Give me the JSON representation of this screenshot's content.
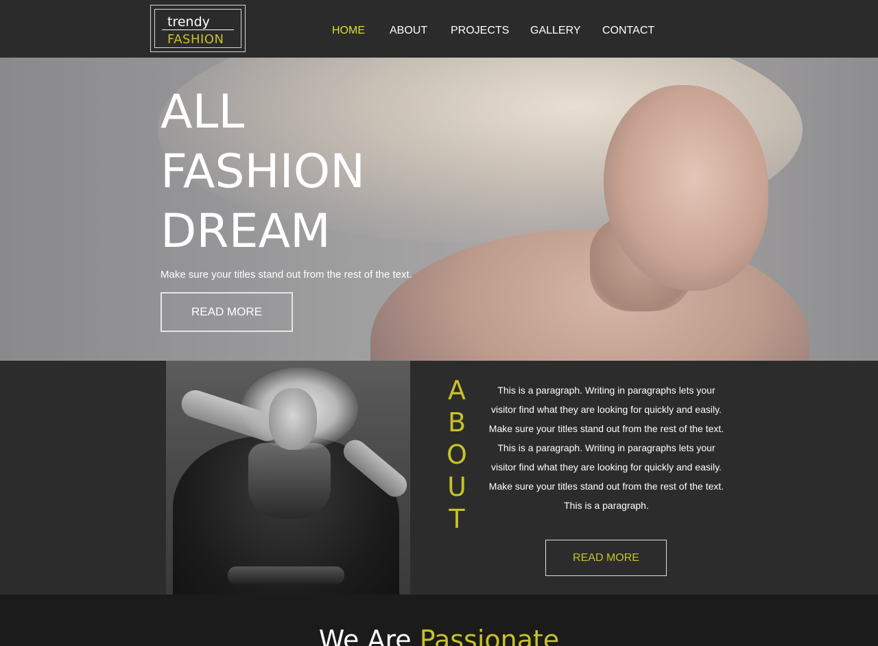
{
  "logo": {
    "line1": "trendy",
    "line2": "FASHION"
  },
  "nav": {
    "items": [
      {
        "label": "HOME",
        "active": true
      },
      {
        "label": "ABOUT",
        "active": false
      },
      {
        "label": "PROJECTS",
        "active": false
      },
      {
        "label": "GALLERY",
        "active": false
      },
      {
        "label": "CONTACT",
        "active": false
      }
    ]
  },
  "hero": {
    "title_lines": [
      "ALL",
      "FASHION",
      "DREAM"
    ],
    "subtitle": "Make sure your titles stand out from the rest of the text.",
    "button_label": "READ MORE"
  },
  "about": {
    "letters": [
      "A",
      "B",
      "O",
      "U",
      "T"
    ],
    "paragraph": "This is a paragraph. Writing in paragraphs lets your visitor find what they are looking for quickly and easily. Make sure your titles stand out from the rest of the text. This is a paragraph. Writing in paragraphs lets your visitor find what they are looking for quickly and easily. Make sure your titles stand out from the rest of the text. This is a paragraph.",
    "button_label": "READ MORE"
  },
  "passion": {
    "title_part1": "We Are",
    "title_part2": "Passionate"
  },
  "colors": {
    "accent": "#c8c22a",
    "nav_active": "#d4e22a",
    "background": "#2b2b2b",
    "footer_bg": "#1b1b1b"
  }
}
